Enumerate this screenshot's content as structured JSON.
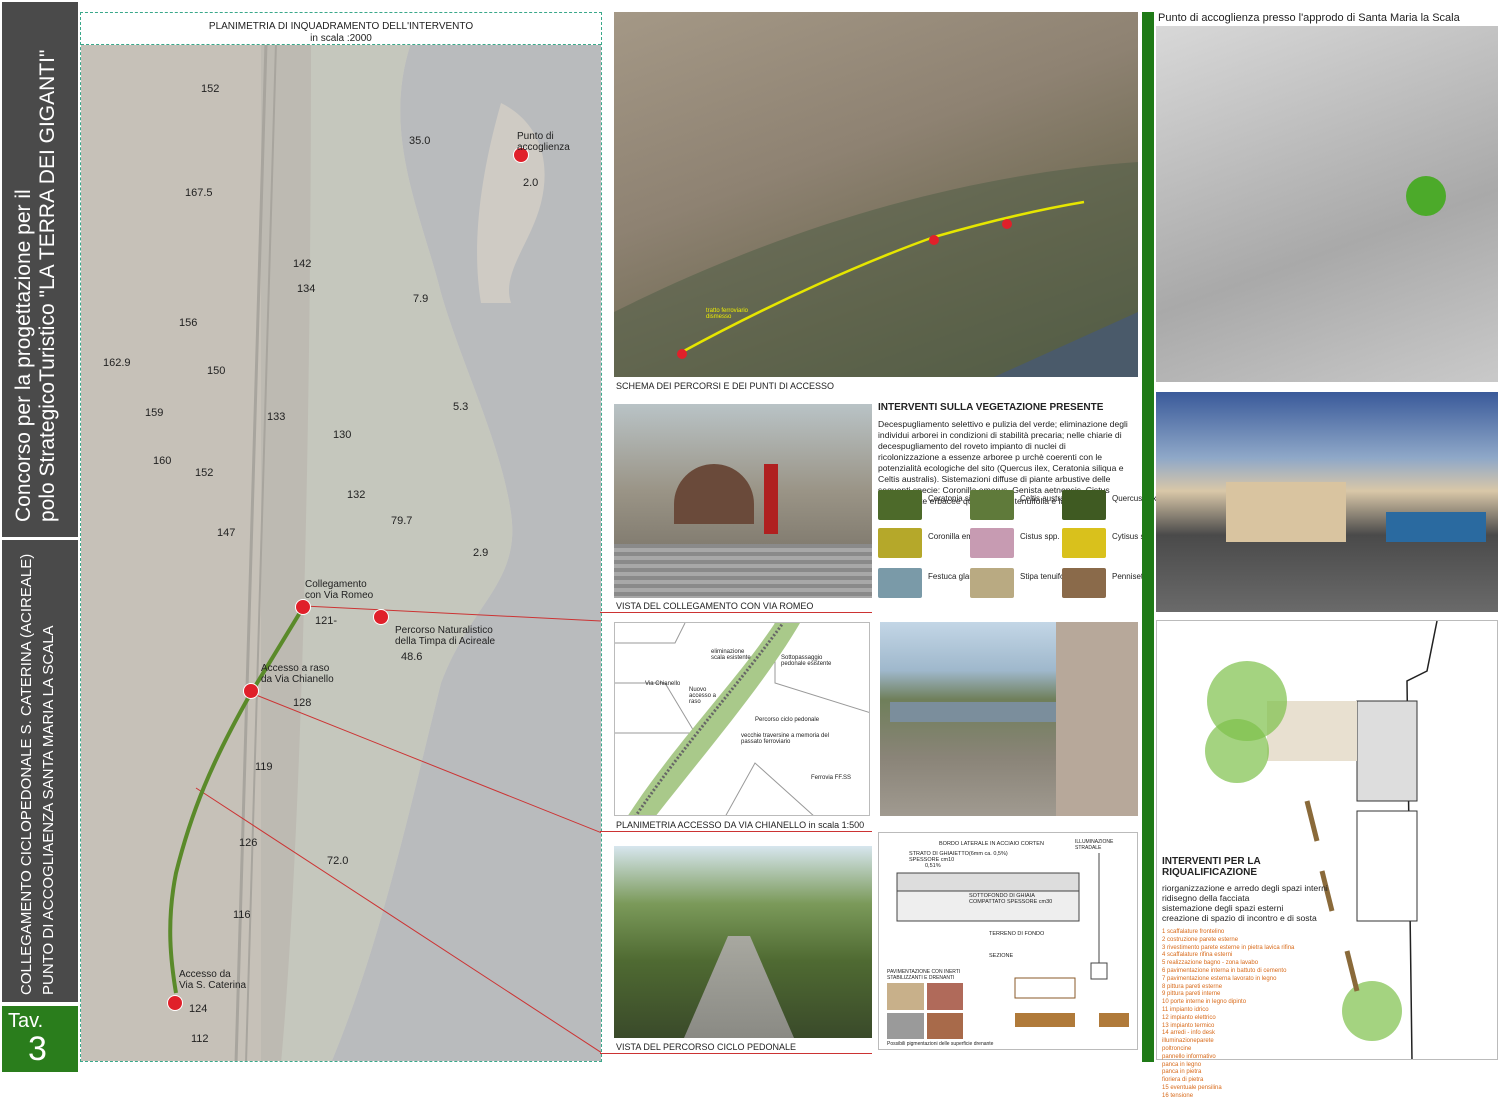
{
  "sidebar": {
    "title_line1": "Concorso per la progettazione per il",
    "title_line2": "polo StrategicoTuristico \"LA TERRA DEI GIGANTI\"",
    "subtitle_line1": "COLLEGAMENTO CICLOPEDONALE S. CATERINA (ACIREALE)",
    "subtitle_line2": "PUNTO DI ACCOGLIAENZA SANTA MARIA LA SCALA",
    "tav_label": "Tav.",
    "tav_number": "3"
  },
  "map": {
    "title": "PLANIMETRIA DI INQUADRAMENTO DELL'INTERVENTO",
    "scale": "in scala :2000",
    "elevations": [
      "152",
      "35.0",
      "2.0",
      "167.5",
      "142",
      "134",
      "7.9",
      "156",
      "162.9",
      "150",
      "5.3",
      "159",
      "133",
      "130",
      "160",
      "152",
      "132",
      "79.7",
      "147",
      "2.9",
      "121-",
      "48.6",
      "128",
      "119",
      "126",
      "72.0",
      "116",
      "124",
      "112"
    ],
    "points": [
      {
        "label_a": "Punto di",
        "label_b": "accoglienza"
      },
      {
        "label_a": "Collegamento",
        "label_b": "con Via Romeo"
      },
      {
        "label_a": "Percorso Naturalistico",
        "label_b": "della Timpa di Acireale"
      },
      {
        "label_a": "Accesso a raso",
        "label_b": "da Via Chianello"
      },
      {
        "label_a": "Accesso da",
        "label_b": "Via S. Caterina"
      }
    ]
  },
  "aerial": {
    "caption": "SCHEMA DEI PERCORSI E DEI PUNTI DI ACCESSO",
    "route_label": "tratto ferroviario dismesso"
  },
  "vegetation": {
    "title": "INTERVENTI SULLA VEGETAZIONE PRESENTE",
    "text": "Decespugliamento selettivo e pulizia del verde; eliminazione degli individui arborei in condizioni di stabilità precaria; nelle chiarie di decespugliamento del roveto impianto di nuclei di ricolonizzazione a essenze arboree p urchè coerenti con le potenzialità ecologiche del sito (Quercus ilex, Ceratonia siliqua e Celtis australis). Sistemazioni diffuse di piante arbustive delle seguenti specie: Coronilla emerus, Genista aetnensis, Cistus spp. e piante erbacee quali la Stipa tenuifolia e la Festuca glauca.",
    "plants": [
      "Ceratonia siliqua",
      "Celtis australis",
      "Quercus ilex",
      "Coronilla emerus",
      "Cistus spp.",
      "Cytisus spp",
      "Festuca glauca",
      "Stipa tenuifolia",
      "Pennisetum setaceum"
    ]
  },
  "captions": {
    "romeo": "VISTA DEL COLLEGAMENTO CON VIA ROMEO",
    "chianello": "PLANIMETRIA ACCESSO DA VIA CHIANELLO  in scala 1:500",
    "percorso": "VISTA DEL PERCORSO CICLO PEDONALE"
  },
  "plan_labels": {
    "via_chianello": "Via Chianello",
    "nuovo_accesso": "Nuovo accesso a raso",
    "eliminazione": "eliminazione scala esistente",
    "sottopassaggio": "Sottopassaggio pedonale esistente",
    "percorso": "Percorso ciclo pedonale",
    "traversine": "vecchie traversine a memoria del passato ferroviario",
    "ferrovia": "Ferrovia FF.SS"
  },
  "section": {
    "bordo": "BORDO LATERALE IN ACCIAIO CORTEN",
    "strato": "STRATO DI GHIAIETTO(6mm  ca. 0,5%) SPESSORE cm10",
    "sottofondo": "SOTTOFONDO DI GHIAIA COMPATTATO SPESSORE cm30",
    "terreno": "TERRENO DI FONDO",
    "sezione": "SEZIONE",
    "illuminazione": "ILLUMINAZIONE STRADALE",
    "pavimentazione": "PAVIMENTAZIONE CON INERTI STABILIZZANTI E DRENANTI",
    "posti": "Possibili pigmentazioni delle superficie drenante",
    "slope": "0,51%"
  },
  "right": {
    "title": "Punto di accoglienza presso l'approdo di Santa Maria la Scala",
    "int_title": "INTERVENTI PER LA RIQUALIFICAZIONE",
    "int_items": [
      "riorganizzazione e arredo degli spazi interni",
      "ridisegno della facciata",
      "sistemazione degli spazi esterni",
      "creazione di spazio di incontro e di sosta"
    ],
    "legend": [
      "1  scaffalature frontelino",
      "2  costruzione parete esterne",
      "3  rivestimento parete esterne in pietra lavica rifina",
      "4  scaffalature rifina esterni",
      "5  realizzazione bagno - zona lavabo",
      "6  pavimentazione interna in battuto di cemento",
      "7  pavimentazione esterna lavorato in legno",
      "8  pittura pareti esterne",
      "9  pittura pareti interne",
      "10 porte interne in legno dipinto",
      "11 impianto idrico",
      "12 impianto elettrico",
      "13 impianto termico",
      "14 arredi - info desk",
      "   illuminazioneparete",
      "   poltroncine",
      "   pannello informativo",
      "   panca in legno",
      "   panca in pietra",
      "   fioriera di pietra",
      "15 eventuale pensilina",
      "16 tensione"
    ]
  },
  "colors": {
    "sidebar": "#4a4a4a",
    "tav": "#2a7d1c",
    "accent_green": "#1f7a17",
    "pin": "#e0202a",
    "path": "#5a8a2a",
    "orange": "#d86a1a"
  }
}
